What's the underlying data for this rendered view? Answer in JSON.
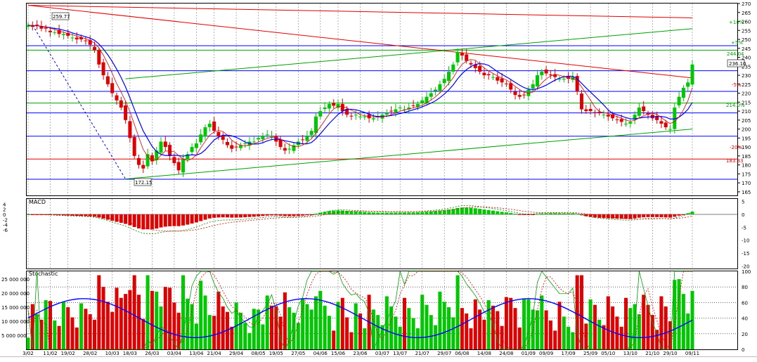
{
  "app": {
    "colors": {
      "bg": "#ffffff",
      "up": "#00c800",
      "down": "#e00000",
      "ma": "#0000ff",
      "grid": "#808080"
    }
  },
  "chart_data": [
    {
      "type": "candlestick",
      "ylim": [
        163,
        270
      ],
      "yticks": [
        165,
        170,
        175,
        180,
        185,
        190,
        195,
        200,
        205,
        210,
        215,
        220,
        225,
        230,
        235,
        240,
        245,
        250,
        255,
        260,
        265,
        270
      ],
      "xticks": [
        "3/02",
        "11/02",
        "19/02",
        "28/02",
        "10/03",
        "18/03",
        "26/03",
        "03/04",
        "13/04",
        "21/04",
        "29/04",
        "08/05",
        "19/05",
        "27/05",
        "04/06",
        "15/06",
        "23/06",
        "03/07",
        "13/07",
        "21/07",
        "29/07",
        "06/08",
        "14/08",
        "24/08",
        "01/09",
        "09/09",
        "17/09",
        "25/09",
        "05/10",
        "13/10",
        "21/10",
        "29/10",
        "09/11"
      ],
      "annotations": {
        "high_label": "259.77",
        "low_label": "172.15",
        "last_price": "236.10",
        "level_244": "244.04",
        "pct_plus10": "+10%",
        "pct_plus5": "+5%",
        "pct_minus5": "-5%",
        "pct_minus20": "-20%",
        "level_214": "214.0%",
        "level_183": "183.33"
      },
      "horizontal_levels": [
        {
          "value": 246.5,
          "color": "#0000ff"
        },
        {
          "value": 244.0,
          "color": "#00a000"
        },
        {
          "value": 232.5,
          "color": "#0000ff"
        },
        {
          "value": 221.0,
          "color": "#0000ff"
        },
        {
          "value": 214.5,
          "color": "#00a000"
        },
        {
          "value": 209.0,
          "color": "#0000ff"
        },
        {
          "value": 196.0,
          "color": "#0000ff"
        },
        {
          "value": 183.3,
          "color": "#e00000"
        },
        {
          "value": 172.0,
          "color": "#0000ff"
        }
      ],
      "trendlines": [
        {
          "from": [
            0,
            269
          ],
          "to": [
            150,
            262
          ],
          "color": "#e00000"
        },
        {
          "from": [
            0,
            269
          ],
          "to": [
            150,
            228.5
          ],
          "color": "#e00000"
        },
        {
          "from": [
            22,
            228
          ],
          "to": [
            150,
            256
          ],
          "color": "#00a000"
        },
        {
          "from": [
            22,
            172.15
          ],
          "to": [
            150,
            200
          ],
          "color": "#00a000"
        }
      ],
      "closes": [
        258,
        257,
        258,
        256,
        256,
        254,
        254,
        253,
        253,
        252,
        251,
        250,
        250,
        249,
        247,
        244,
        236,
        230,
        225,
        220,
        216,
        212,
        205,
        195,
        185,
        180,
        178,
        186,
        182,
        188,
        193,
        190,
        185,
        181,
        177,
        183,
        186,
        190,
        192,
        197,
        201,
        203,
        199,
        196,
        194,
        191,
        189,
        190,
        191,
        192,
        193,
        193,
        195,
        196,
        197,
        196,
        193,
        190,
        188,
        189,
        191,
        193,
        194,
        196,
        199,
        207,
        210,
        212,
        214,
        213,
        214,
        210,
        208,
        207,
        208,
        207,
        207,
        206,
        206,
        207,
        208,
        209,
        210,
        211,
        212,
        211,
        212,
        213,
        214,
        216,
        218,
        220,
        222,
        225,
        228,
        232,
        236,
        243,
        241,
        238,
        236,
        234,
        232,
        230,
        230,
        229,
        227,
        226,
        225,
        222,
        219,
        218,
        219,
        222,
        225,
        230,
        232,
        231,
        230,
        229,
        228,
        228,
        228,
        229,
        221,
        211,
        210,
        210,
        209,
        209,
        208,
        207,
        206,
        205,
        204,
        203,
        204,
        208,
        212,
        210,
        208,
        206,
        205,
        203,
        201,
        200,
        212,
        218,
        223,
        226,
        236
      ]
    },
    {
      "type": "macd",
      "title": "MACD",
      "ylim": [
        -21,
        6
      ],
      "yticks_left": [
        4,
        2,
        0,
        -2,
        -4,
        -6
      ],
      "yticks_right": [
        5,
        0,
        -5,
        -10,
        -15,
        -20
      ]
    },
    {
      "type": "stochastic",
      "title": "Stochastic",
      "yticks_left": [
        "25 000 000",
        "20 000 000",
        "15 000 000",
        "10 000 000",
        "5 000 000"
      ],
      "yticks_right": [
        100,
        80,
        60,
        40,
        20,
        0
      ]
    }
  ]
}
